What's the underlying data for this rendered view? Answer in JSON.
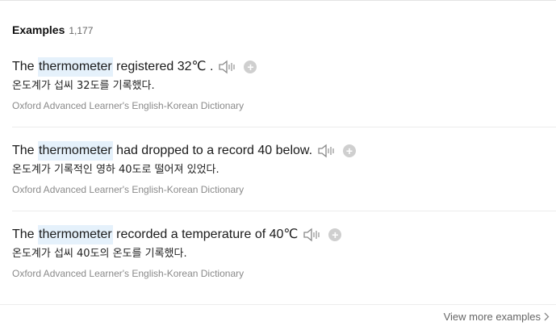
{
  "header": {
    "title": "Examples",
    "count": "1,177"
  },
  "examples": [
    {
      "pre": "The ",
      "highlight": "thermometer",
      "post": " registered 32℃ .",
      "translation": "온도계가 섭씨 32도를 기록했다.",
      "source": "Oxford Advanced Learner's English-Korean Dictionary"
    },
    {
      "pre": "The ",
      "highlight": "thermometer",
      "post": " had dropped to a record 40 below.",
      "translation": "온도계가 기록적인 영하 40도로 떨어져 있었다.",
      "source": "Oxford Advanced Learner's English-Korean Dictionary"
    },
    {
      "pre": "The ",
      "highlight": "thermometer",
      "post": " recorded a temperature of 40℃",
      "translation": "온도계가 섭씨 40도의 온도를 기록했다.",
      "source": "Oxford Advanced Learner's English-Korean Dictionary"
    }
  ],
  "icons": {
    "speaker": "speaker-icon",
    "add": "plus-circle-icon",
    "more": "chevron-right-icon"
  },
  "footer": {
    "view_more": "View more examples"
  }
}
